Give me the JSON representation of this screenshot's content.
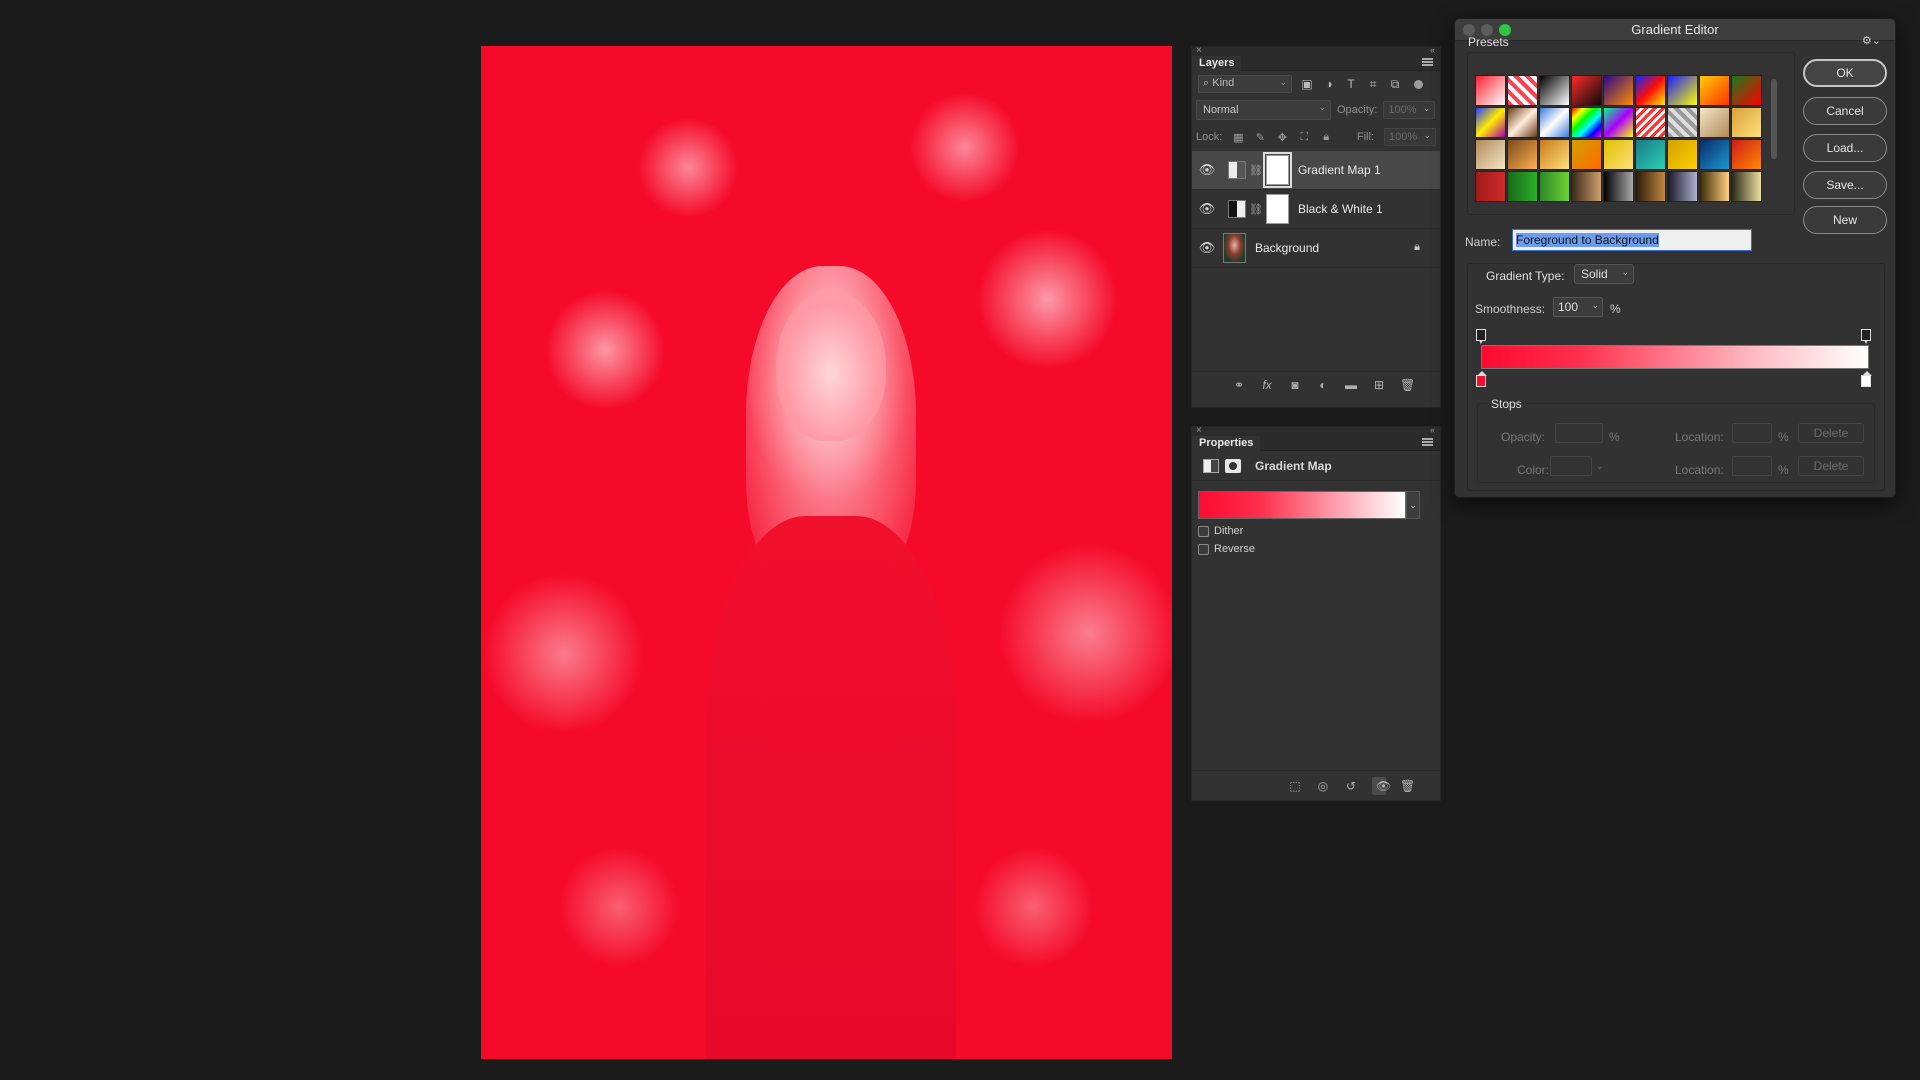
{
  "layers_panel": {
    "tab_label": "Layers",
    "kind_filter": "Kind",
    "blend_mode": "Normal",
    "opacity_label": "Opacity:",
    "opacity_value": "100%",
    "lock_label": "Lock:",
    "fill_label": "Fill:",
    "fill_value": "100%",
    "layers": [
      {
        "name": "Gradient Map 1",
        "selected": true
      },
      {
        "name": "Black & White 1",
        "selected": false
      },
      {
        "name": "Background",
        "selected": false,
        "locked": true
      }
    ]
  },
  "properties_panel": {
    "tab_label": "Properties",
    "adjustment_title": "Gradient Map",
    "dither_label": "Dither",
    "reverse_label": "Reverse",
    "dither_checked": false,
    "reverse_checked": false
  },
  "gradient_editor": {
    "title": "Gradient Editor",
    "presets_label": "Presets",
    "buttons": {
      "ok": "OK",
      "cancel": "Cancel",
      "load": "Load...",
      "save": "Save...",
      "new": "New"
    },
    "name_label": "Name:",
    "name_value": "Foreground to Background",
    "gradient_type_label": "Gradient Type:",
    "gradient_type_value": "Solid",
    "smoothness_label": "Smoothness:",
    "smoothness_value": "100",
    "percent_symbol": "%",
    "stops_label": "Stops",
    "opacity_label": "Opacity:",
    "color_label": "Color:",
    "location_label": "Location:",
    "delete_label": "Delete",
    "start_color": "#ff0a30",
    "end_color": "#ffffff"
  }
}
